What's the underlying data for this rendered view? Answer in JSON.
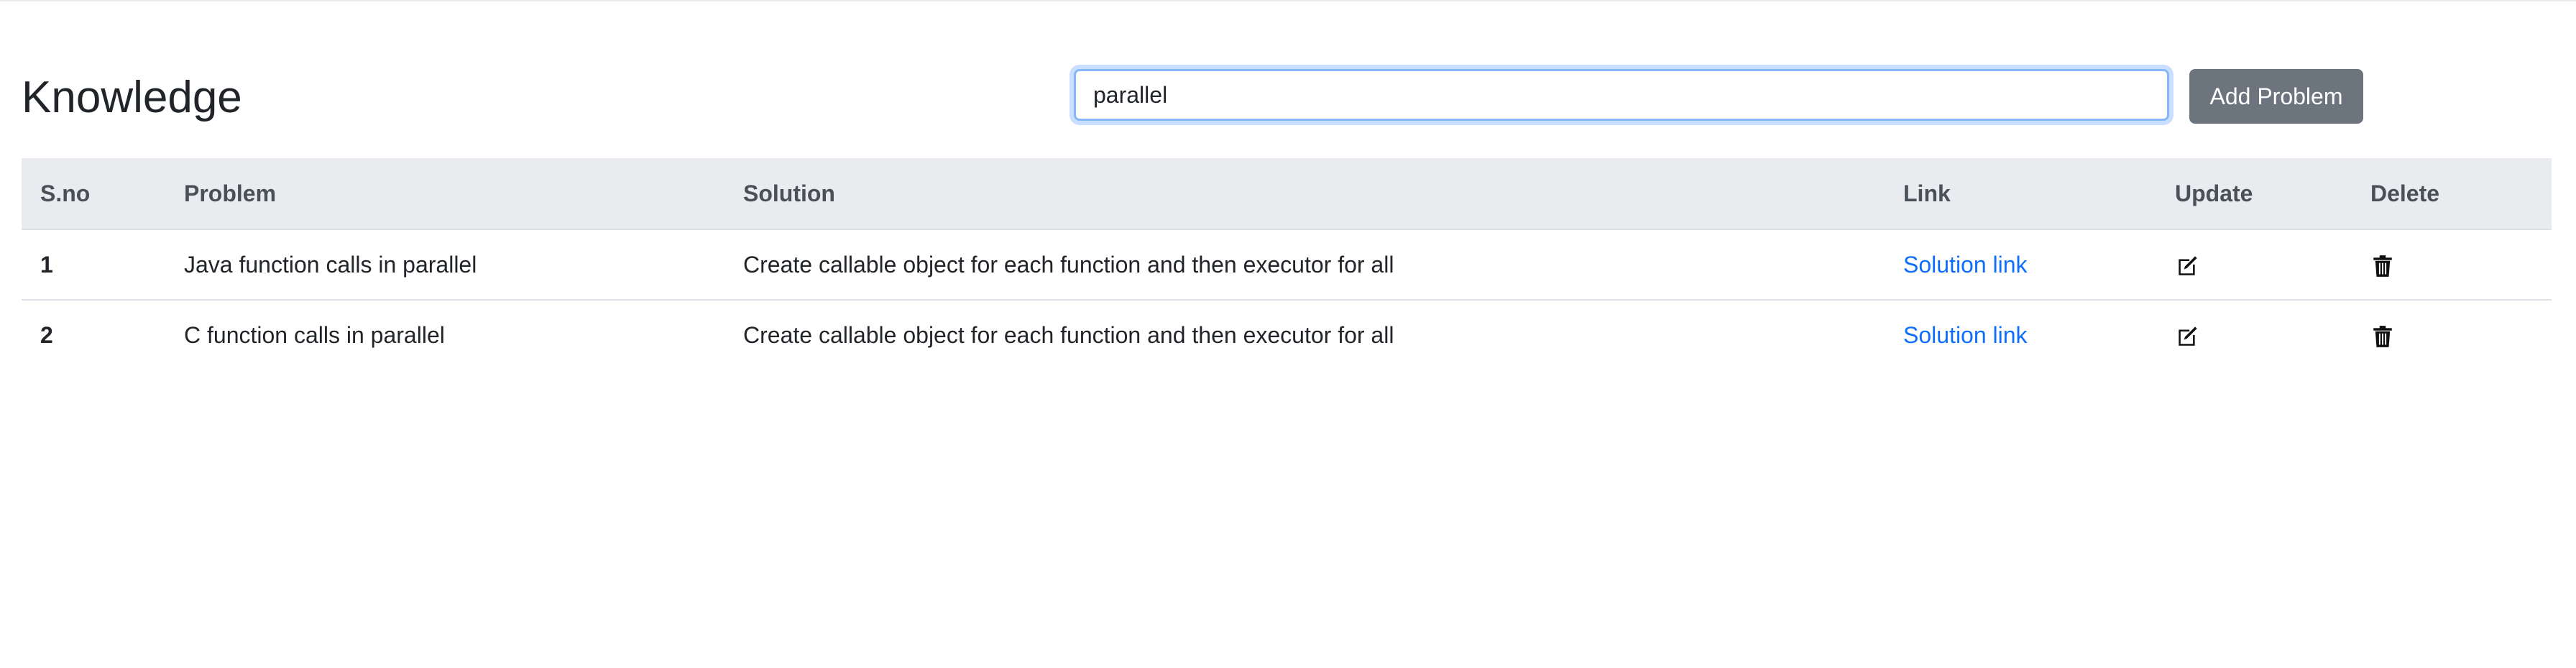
{
  "header": {
    "title": "Knowledge",
    "search": {
      "value": "parallel",
      "placeholder": ""
    },
    "add_button_label": "Add Problem"
  },
  "table": {
    "columns": [
      "S.no",
      "Problem",
      "Solution",
      "Link",
      "Update",
      "Delete"
    ],
    "rows": [
      {
        "sno": "1",
        "problem": "Java function calls in parallel",
        "solution": "Create callable object for each function and then executor for all",
        "link_label": "Solution link",
        "update_icon": "edit-icon",
        "delete_icon": "trash-icon"
      },
      {
        "sno": "2",
        "problem": "C function calls in parallel",
        "solution": "Create callable object for each function and then executor for all",
        "link_label": "Solution link",
        "update_icon": "edit-icon",
        "delete_icon": "trash-icon"
      }
    ]
  },
  "colors": {
    "link": "#0d6efd",
    "button": "#6c757d",
    "header_bg": "#e9ebef",
    "focus_border": "#86b7fe"
  }
}
